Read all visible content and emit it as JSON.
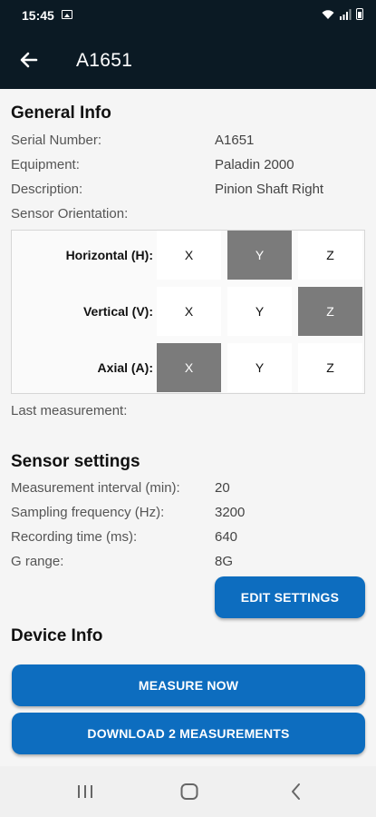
{
  "status_bar": {
    "time": "15:45"
  },
  "app_bar": {
    "title": "A1651"
  },
  "general_info": {
    "title": "General Info",
    "rows": [
      {
        "label": "Serial Number:",
        "value": "A1651"
      },
      {
        "label": "Equipment:",
        "value": "Paladin 2000"
      },
      {
        "label": "Description:",
        "value": "Pinion Shaft Right"
      },
      {
        "label": "Sensor Orientation:",
        "value": ""
      }
    ]
  },
  "orientation": {
    "rows": [
      {
        "label": "Horizontal (H):",
        "options": [
          "X",
          "Y",
          "Z"
        ],
        "selected": "Y"
      },
      {
        "label": "Vertical (V):",
        "options": [
          "X",
          "Y",
          "Z"
        ],
        "selected": "Z"
      },
      {
        "label": "Axial (A):",
        "options": [
          "X",
          "Y",
          "Z"
        ],
        "selected": "X"
      }
    ]
  },
  "last_measurement": {
    "label": "Last measurement:"
  },
  "sensor_settings": {
    "title": "Sensor settings",
    "rows": [
      {
        "label": "Measurement interval (min):",
        "value": "20"
      },
      {
        "label": "Sampling frequency (Hz):",
        "value": "3200"
      },
      {
        "label": "Recording time (ms):",
        "value": "640"
      },
      {
        "label": "G range:",
        "value": "8G"
      }
    ],
    "edit_button": "EDIT SETTINGS"
  },
  "device_info": {
    "title": "Device Info"
  },
  "actions": {
    "measure_now": "MEASURE NOW",
    "download": "DOWNLOAD 2 MEASUREMENTS"
  },
  "colors": {
    "primary": "#0d6dbf",
    "header_bg": "#0b1a24",
    "selected_cell": "#7b7b7b"
  },
  "icons": [
    "image-icon",
    "wifi-icon",
    "signal-icon",
    "battery-icon",
    "back-arrow-icon",
    "recent-apps-icon",
    "home-icon",
    "back-nav-icon"
  ]
}
